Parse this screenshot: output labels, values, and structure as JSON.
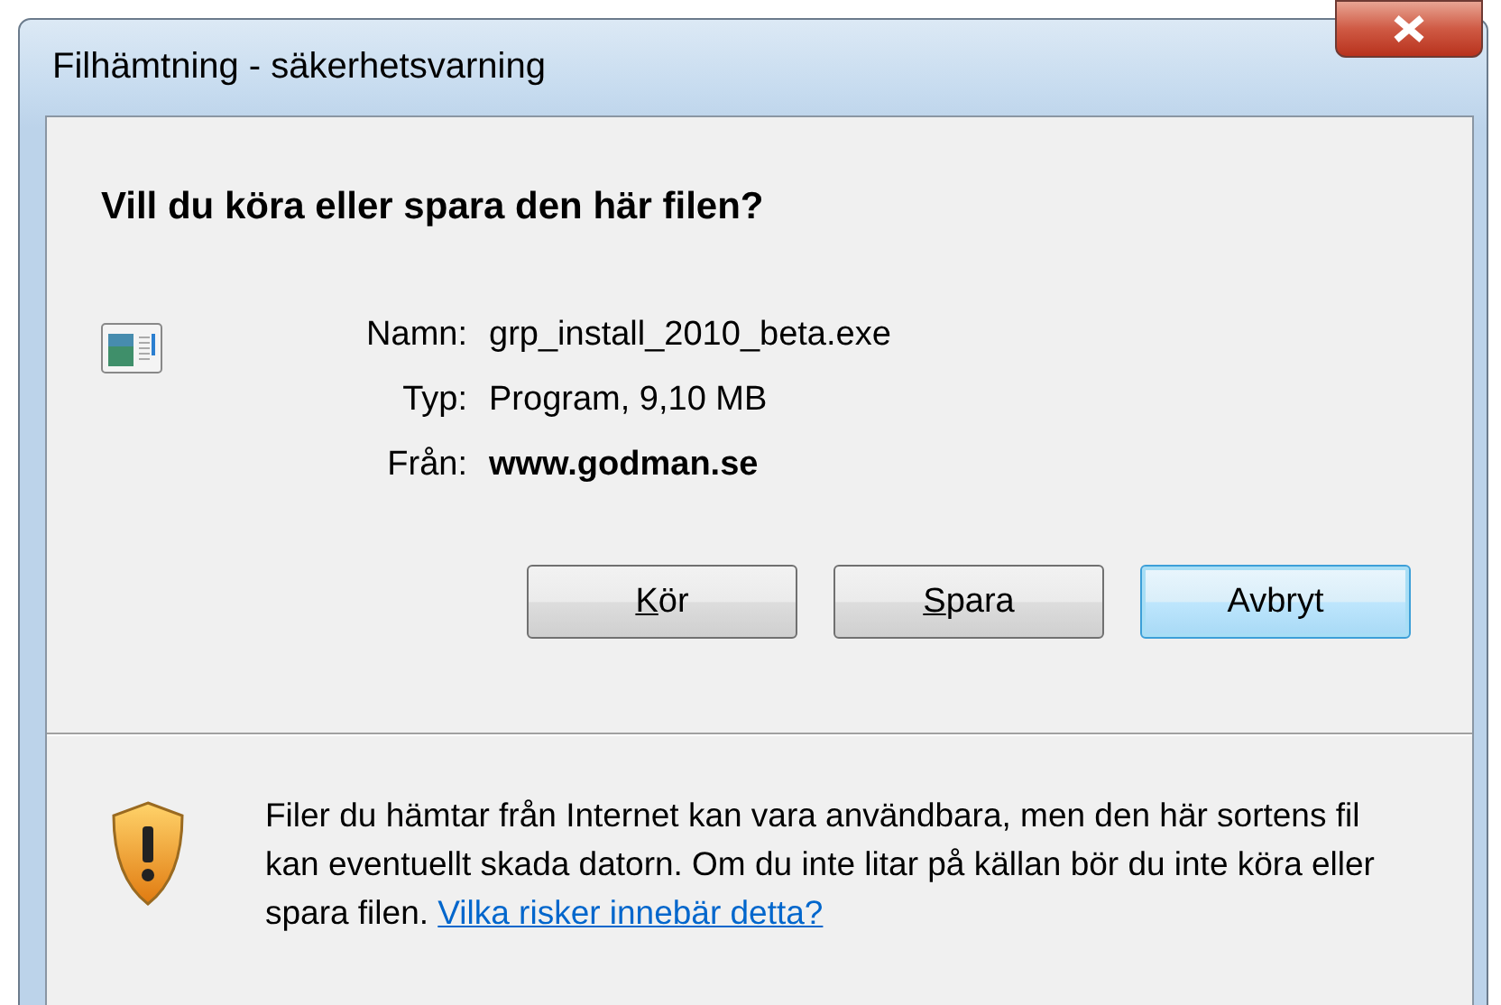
{
  "window": {
    "title": "Filhämtning - säkerhetsvarning"
  },
  "heading": "Vill du köra eller spara den här filen?",
  "file_info": [
    {
      "label": "Namn:",
      "value": "grp_install_2010_beta.exe",
      "bold": false
    },
    {
      "label": "Typ:",
      "value": "Program, 9,10 MB",
      "bold": false
    },
    {
      "label": "Från:",
      "value": "www.godman.se",
      "bold": true
    }
  ],
  "buttons": [
    {
      "label": "Kör",
      "mnemonic": true,
      "default": false
    },
    {
      "label": "Spara",
      "mnemonic": true,
      "default": false
    },
    {
      "label": "Avbryt",
      "mnemonic": false,
      "default": true
    }
  ],
  "warning": {
    "text": "Filer du hämtar från Internet kan vara användbara, men den här sortens fil kan eventuellt skada datorn. Om du inte litar på källan bör du inte köra eller spara filen.",
    "link": "Vilka risker innebär detta?"
  }
}
